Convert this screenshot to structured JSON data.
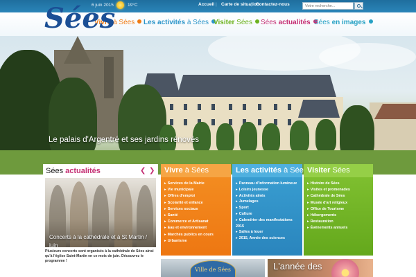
{
  "header": {
    "logo_text": "Sées",
    "date": "6 juin 2015",
    "temperature": "19°C",
    "links": [
      "Accueil",
      "Carte de situation",
      "Contactez-nous"
    ],
    "search_placeholder": "Votre recherche..."
  },
  "nav": {
    "vivre": {
      "main": "Vivre",
      "rest": " à Sées"
    },
    "activites": {
      "main": "Les activités",
      "rest": " à Sées"
    },
    "visiter": {
      "main": "Visiter",
      "rest": " Sées"
    },
    "actualites": {
      "pre": "Sées ",
      "main": "actualités"
    },
    "images": {
      "pre": "Sées ",
      "main": "en images"
    }
  },
  "hero": {
    "caption": "Le palais d'Argentré et ses jardins rénovés"
  },
  "actualites": {
    "title_pre": "Sées ",
    "title_main": "actualités",
    "caption": "Concerts à la cathédrale et à St Martin / juin",
    "text": "Plusieurs concerts sont organisés à la cathédrale de Sées ainsi qu'à l'église Saint-Martin en ce mois de juin. Découvrez le programme !"
  },
  "panels": {
    "vivre": {
      "title_main": "Vivre",
      "title_rest": " à Sées",
      "items": [
        "Services de la Mairie",
        "Vie municipale",
        "Offres d'emploi",
        "Scolarité et enfance",
        "Services sociaux",
        "Santé",
        "Commerce et Artisanat",
        "Eau et environnement",
        "Marchés publics en cours",
        "Urbanisme"
      ]
    },
    "activites": {
      "title_main": "Les activités",
      "title_rest": " à Sées",
      "items": [
        "Panneau d'information lumineux",
        "Loisirs jeunesse",
        "Activités aînés",
        "Jumelages",
        "Sport",
        "Culture",
        "Calendrier des manifestations 2015",
        "Salles à louer",
        "2015, Année des sciences"
      ]
    },
    "visiter": {
      "title_main": "Visiter",
      "title_rest": " Sées",
      "items": [
        "Histoire de Sées",
        "Visites et promenades",
        "Cathédrale de Sées",
        "Musée d'art religieux",
        "Office de Tourisme",
        "Hébergements",
        "Restauration",
        "Événements annuels"
      ]
    }
  },
  "tiles": {
    "ville": "Ville de Sées",
    "annee": "L'année des"
  },
  "colors": {
    "orange": "#f07a12",
    "blue": "#2c95c9",
    "green": "#6cb21e",
    "pink": "#c53074"
  }
}
